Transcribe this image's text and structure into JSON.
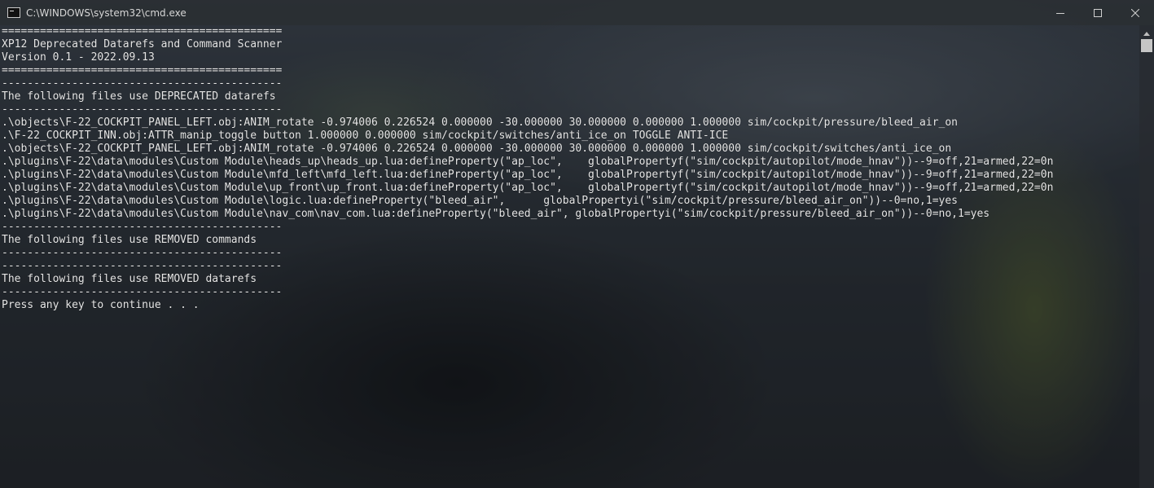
{
  "window": {
    "title": "C:\\WINDOWS\\system32\\cmd.exe",
    "icon": "console-app-icon",
    "controls": {
      "minimize": "minimize-icon",
      "maximize": "maximize-icon",
      "close": "close-icon"
    }
  },
  "console": {
    "lines": [
      "============================================",
      "XP12 Deprecated Datarefs and Command Scanner",
      "Version 0.1 - 2022.09.13",
      "============================================",
      "--------------------------------------------",
      "The following files use DEPRECATED datarefs",
      "--------------------------------------------",
      ".\\objects\\F-22_COCKPIT_PANEL_LEFT.obj:ANIM_rotate -0.974006 0.226524 0.000000 -30.000000 30.000000 0.000000 1.000000 sim/cockpit/pressure/bleed_air_on",
      ".\\F-22_COCKPIT_INN.obj:ATTR_manip_toggle button 1.000000 0.000000 sim/cockpit/switches/anti_ice_on TOGGLE ANTI-ICE",
      ".\\objects\\F-22_COCKPIT_PANEL_LEFT.obj:ANIM_rotate -0.974006 0.226524 0.000000 -30.000000 30.000000 0.000000 1.000000 sim/cockpit/switches/anti_ice_on",
      ".\\plugins\\F-22\\data\\modules\\Custom Module\\heads_up\\heads_up.lua:defineProperty(\"ap_loc\",    globalPropertyf(\"sim/cockpit/autopilot/mode_hnav\"))--9=off,21=armed,22=0n",
      ".\\plugins\\F-22\\data\\modules\\Custom Module\\mfd_left\\mfd_left.lua:defineProperty(\"ap_loc\",    globalPropertyf(\"sim/cockpit/autopilot/mode_hnav\"))--9=off,21=armed,22=0n",
      ".\\plugins\\F-22\\data\\modules\\Custom Module\\up_front\\up_front.lua:defineProperty(\"ap_loc\",    globalPropertyf(\"sim/cockpit/autopilot/mode_hnav\"))--9=off,21=armed,22=0n",
      ".\\plugins\\F-22\\data\\modules\\Custom Module\\logic.lua:defineProperty(\"bleed_air\",      globalPropertyi(\"sim/cockpit/pressure/bleed_air_on\"))--0=no,1=yes",
      ".\\plugins\\F-22\\data\\modules\\Custom Module\\nav_com\\nav_com.lua:defineProperty(\"bleed_air\", globalPropertyi(\"sim/cockpit/pressure/bleed_air_on\"))--0=no,1=yes",
      "--------------------------------------------",
      "The following files use REMOVED commands",
      "--------------------------------------------",
      "--------------------------------------------",
      "The following files use REMOVED datarefs",
      "--------------------------------------------",
      "Press any key to continue . . ."
    ]
  },
  "scrollbar": {
    "up_arrow": "scroll-up-arrow-icon"
  }
}
